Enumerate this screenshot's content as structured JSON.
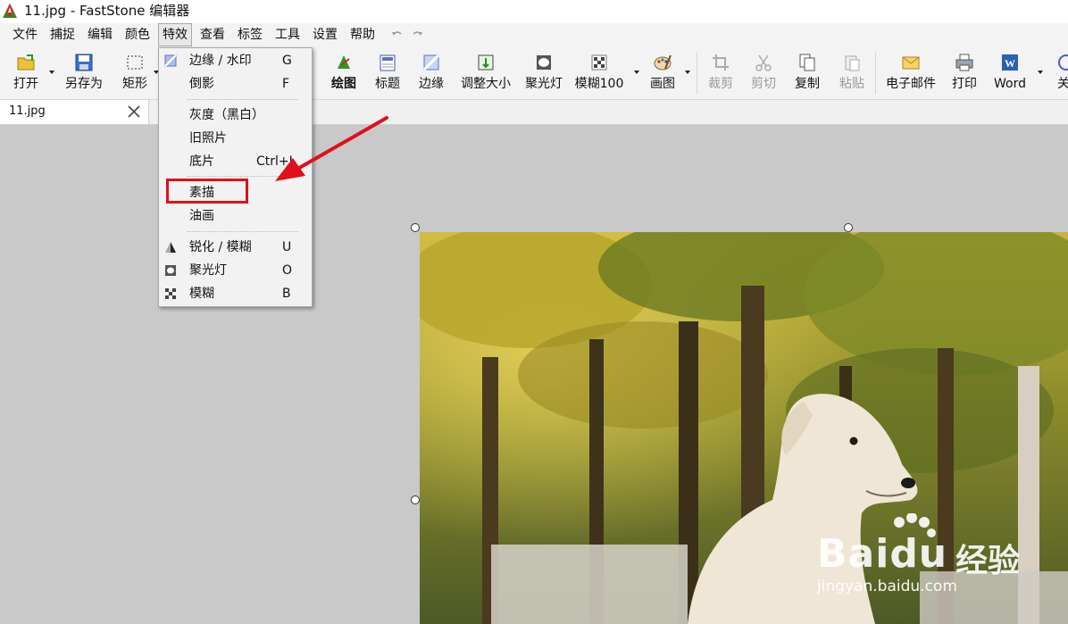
{
  "window": {
    "title": "11.jpg - FastStone 编辑器"
  },
  "menubar": {
    "items": [
      "文件",
      "捕捉",
      "编辑",
      "颜色",
      "特效",
      "查看",
      "标签",
      "工具",
      "设置",
      "帮助"
    ],
    "open_item": "特效"
  },
  "toolbar": {
    "open": "打开",
    "save_as": "另存为",
    "rectangle": "矩形",
    "draw": "绘图",
    "caption": "标题",
    "edge": "边缘",
    "resize": "调整大小",
    "spotlight": "聚光灯",
    "blur": "模糊100",
    "paint": "画图",
    "crop": "裁剪",
    "cut": "剪切",
    "copy": "复制",
    "paste": "粘贴",
    "email": "电子邮件",
    "print": "打印",
    "word": "Word",
    "close_partial": "关"
  },
  "tabs": {
    "doc": "11.jpg"
  },
  "effects_menu": {
    "items": [
      {
        "label": "边缘 / 水印",
        "key": "G",
        "icon": "edge-watermark-icon"
      },
      {
        "label": "倒影",
        "key": "F",
        "icon": ""
      },
      {
        "label": "灰度（黑白）",
        "key": "",
        "icon": ""
      },
      {
        "label": "旧照片",
        "key": "",
        "icon": ""
      },
      {
        "label": "底片",
        "key": "Ctrl+I",
        "icon": ""
      },
      {
        "label": "素描",
        "key": "",
        "icon": ""
      },
      {
        "label": "油画",
        "key": "",
        "icon": ""
      },
      {
        "label": "锐化 / 模糊",
        "key": "U",
        "icon": "sharpen-blur-icon"
      },
      {
        "label": "聚光灯",
        "key": "O",
        "icon": "spotlight-icon"
      },
      {
        "label": "模糊",
        "key": "B",
        "icon": "blur-icon"
      }
    ],
    "highlighted": "素描"
  },
  "watermark": {
    "brand": "Bai",
    "brand2": "du",
    "cn": "经验",
    "url": "jingyan.baidu.com"
  },
  "colors": {
    "annotation_red": "#e0101a",
    "menu_bg": "#f2f2f2",
    "canvas_bg": "#c9c9c9"
  }
}
